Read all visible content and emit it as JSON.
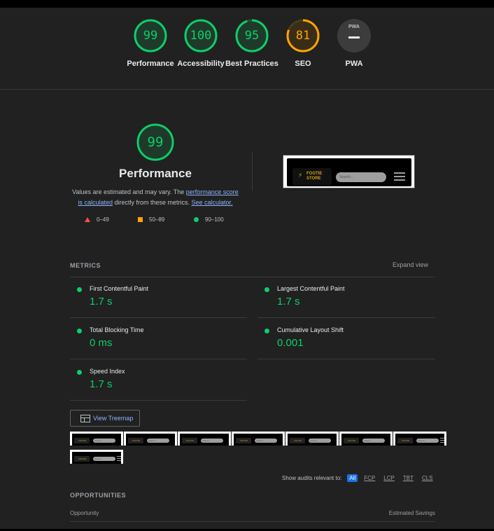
{
  "gauges": [
    {
      "score": "99",
      "label": "Performance",
      "status": "pass",
      "fraction": 0.99
    },
    {
      "score": "100",
      "label": "Accessibility",
      "status": "pass",
      "fraction": 1.0
    },
    {
      "score": "95",
      "label": "Best Practices",
      "status": "pass",
      "fraction": 0.95
    },
    {
      "score": "81",
      "label": "SEO",
      "status": "average",
      "fraction": 0.81
    },
    {
      "score": "PWA",
      "label": "PWA",
      "status": "na"
    }
  ],
  "performance": {
    "score": "99",
    "title": "Performance",
    "desc_1": "Values are estimated and may vary. The ",
    "desc_link_1": "performance score is calculated",
    "desc_2": " directly from these metrics. ",
    "desc_link_2": "See calculator.",
    "legend": {
      "fail": "0–49",
      "average": "50–89",
      "pass": "90–100"
    }
  },
  "screenshot": {
    "logo_line1": "FOOTIE",
    "logo_line2": "STORE",
    "search_placeholder": "Search..."
  },
  "metrics": {
    "section_label": "METRICS",
    "expand_label": "Expand view",
    "items": [
      {
        "name": "First Contentful Paint",
        "value": "1.7 s"
      },
      {
        "name": "Largest Contentful Paint",
        "value": "1.7 s"
      },
      {
        "name": "Total Blocking Time",
        "value": "0 ms"
      },
      {
        "name": "Cumulative Layout Shift",
        "value": "0.001"
      },
      {
        "name": "Speed Index",
        "value": "1.7 s"
      }
    ]
  },
  "treemap": {
    "label": "View Treemap"
  },
  "filters": {
    "label": "Show audits relevant to:",
    "options": [
      "All",
      "FCP",
      "LCP",
      "TBT",
      "CLS"
    ],
    "selected": "All"
  },
  "opportunities": {
    "section_label": "OPPORTUNITIES",
    "col_left": "Opportunity",
    "col_right": "Estimated Savings"
  },
  "colors": {
    "pass": "#0cce6b",
    "average": "#ffa400",
    "fail": "#ff4e42",
    "link": "#8ab4f8",
    "background": "#212121"
  }
}
